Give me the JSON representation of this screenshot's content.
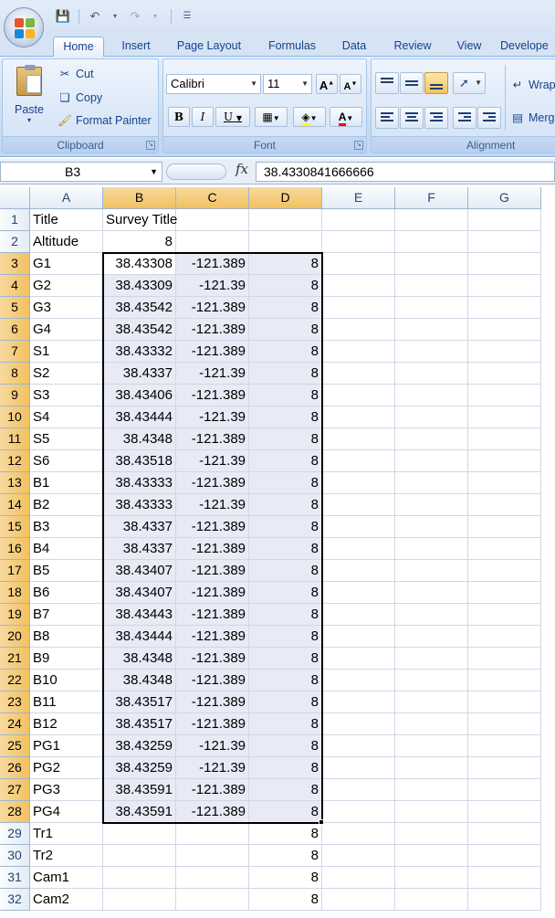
{
  "quick_access": {
    "icons": [
      "save-icon",
      "undo-icon",
      "redo-icon",
      "customize-icon"
    ]
  },
  "tabs": [
    "Home",
    "Insert",
    "Page Layout",
    "Formulas",
    "Data",
    "Review",
    "View",
    "Develope"
  ],
  "clipboard": {
    "paste": "Paste",
    "cut": "Cut",
    "copy": "Copy",
    "format_painter": "Format Painter",
    "label": "Clipboard"
  },
  "font": {
    "name": "Calibri",
    "size": "11",
    "label": "Font",
    "bold": "B",
    "italic": "I",
    "underline": "U"
  },
  "alignment": {
    "label": "Alignment",
    "wrap": "Wrap",
    "merge": "Merg"
  },
  "formula_bar": {
    "name_box": "B3",
    "fx": "fx",
    "value": "38.4330841666666"
  },
  "columns": [
    "A",
    "B",
    "C",
    "D",
    "E",
    "F",
    "G"
  ],
  "selected_columns": [
    "B",
    "C",
    "D"
  ],
  "rows": [
    {
      "n": "1",
      "a": "Title",
      "b": "Survey Title",
      "c": "",
      "d": ""
    },
    {
      "n": "2",
      "a": "Altitude",
      "b": "8",
      "c": "",
      "d": ""
    },
    {
      "n": "3",
      "a": "G1",
      "b": "38.43308",
      "c": "-121.389",
      "d": "8"
    },
    {
      "n": "4",
      "a": "G2",
      "b": "38.43309",
      "c": "-121.39",
      "d": "8"
    },
    {
      "n": "5",
      "a": "G3",
      "b": "38.43542",
      "c": "-121.389",
      "d": "8"
    },
    {
      "n": "6",
      "a": "G4",
      "b": "38.43542",
      "c": "-121.389",
      "d": "8"
    },
    {
      "n": "7",
      "a": "S1",
      "b": "38.43332",
      "c": "-121.389",
      "d": "8"
    },
    {
      "n": "8",
      "a": "S2",
      "b": "38.4337",
      "c": "-121.39",
      "d": "8"
    },
    {
      "n": "9",
      "a": "S3",
      "b": "38.43406",
      "c": "-121.389",
      "d": "8"
    },
    {
      "n": "10",
      "a": "S4",
      "b": "38.43444",
      "c": "-121.39",
      "d": "8"
    },
    {
      "n": "11",
      "a": "S5",
      "b": "38.4348",
      "c": "-121.389",
      "d": "8"
    },
    {
      "n": "12",
      "a": "S6",
      "b": "38.43518",
      "c": "-121.39",
      "d": "8"
    },
    {
      "n": "13",
      "a": "B1",
      "b": "38.43333",
      "c": "-121.389",
      "d": "8"
    },
    {
      "n": "14",
      "a": "B2",
      "b": "38.43333",
      "c": "-121.39",
      "d": "8"
    },
    {
      "n": "15",
      "a": "B3",
      "b": "38.4337",
      "c": "-121.389",
      "d": "8"
    },
    {
      "n": "16",
      "a": "B4",
      "b": "38.4337",
      "c": "-121.389",
      "d": "8"
    },
    {
      "n": "17",
      "a": "B5",
      "b": "38.43407",
      "c": "-121.389",
      "d": "8"
    },
    {
      "n": "18",
      "a": "B6",
      "b": "38.43407",
      "c": "-121.389",
      "d": "8"
    },
    {
      "n": "19",
      "a": "B7",
      "b": "38.43443",
      "c": "-121.389",
      "d": "8"
    },
    {
      "n": "20",
      "a": "B8",
      "b": "38.43444",
      "c": "-121.389",
      "d": "8"
    },
    {
      "n": "21",
      "a": "B9",
      "b": "38.4348",
      "c": "-121.389",
      "d": "8"
    },
    {
      "n": "22",
      "a": "B10",
      "b": "38.4348",
      "c": "-121.389",
      "d": "8"
    },
    {
      "n": "23",
      "a": "B11",
      "b": "38.43517",
      "c": "-121.389",
      "d": "8"
    },
    {
      "n": "24",
      "a": "B12",
      "b": "38.43517",
      "c": "-121.389",
      "d": "8"
    },
    {
      "n": "25",
      "a": "PG1",
      "b": "38.43259",
      "c": "-121.39",
      "d": "8"
    },
    {
      "n": "26",
      "a": "PG2",
      "b": "38.43259",
      "c": "-121.39",
      "d": "8"
    },
    {
      "n": "27",
      "a": "PG3",
      "b": "38.43591",
      "c": "-121.389",
      "d": "8"
    },
    {
      "n": "28",
      "a": "PG4",
      "b": "38.43591",
      "c": "-121.389",
      "d": "8"
    },
    {
      "n": "29",
      "a": "Tr1",
      "b": "",
      "c": "",
      "d": "8"
    },
    {
      "n": "30",
      "a": "Tr2",
      "b": "",
      "c": "",
      "d": "8"
    },
    {
      "n": "31",
      "a": "Cam1",
      "b": "",
      "c": "",
      "d": "8"
    },
    {
      "n": "32",
      "a": "Cam2",
      "b": "",
      "c": "",
      "d": "8"
    }
  ]
}
